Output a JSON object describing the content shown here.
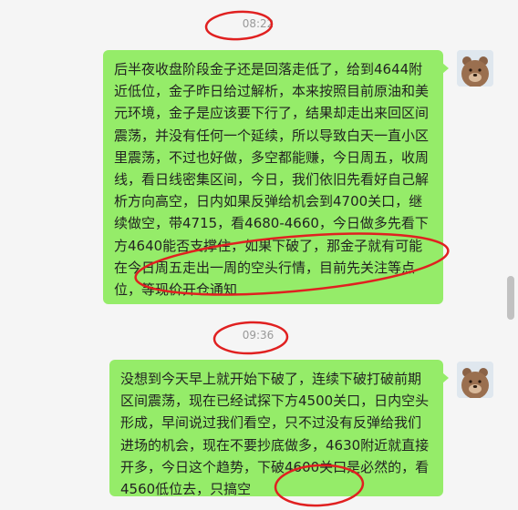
{
  "chat": {
    "messages": [
      {
        "time": "08:22",
        "text": "后半夜收盘阶段金子还是回落走低了，给到4644附近低位，金子昨日给过解析，本来按照目前原油和美元环境，金子是应该要下行了，结果却走出来回区间震荡，并没有任何一个延续，所以导致白天一直小区里震荡，不过也好做，多空都能赚，今日周五，收周线，看日线密集区间，今日，我们依旧先看好自己解析方向高空，日内如果反弹给机会到4700关口，继续做空，带4715，看4680-4660，今日做多先看下方4640能否支撑住，如果下破了，那金子就有可能在今日周五走出一周的空头行情，目前先关注等点位，等现价开仓通知"
      },
      {
        "time": "09:36",
        "text": "没想到今天早上就开始下破了，连续下破打破前期区间震荡，现在已经试探下方4500关口，日内空头形成，早间说过我们看空，只不过没有反弹给我们进场的机会，现在不要抄底做多，4630附近就直接开多，今日这个趋势，下破4600关口是必然的，看4560低位去，只搞空"
      }
    ]
  },
  "colors": {
    "bubble": "#95ec69",
    "background": "#f5f5f5",
    "annotation": "#e02020"
  },
  "icons": {
    "avatar": "bear-avatar-icon"
  }
}
